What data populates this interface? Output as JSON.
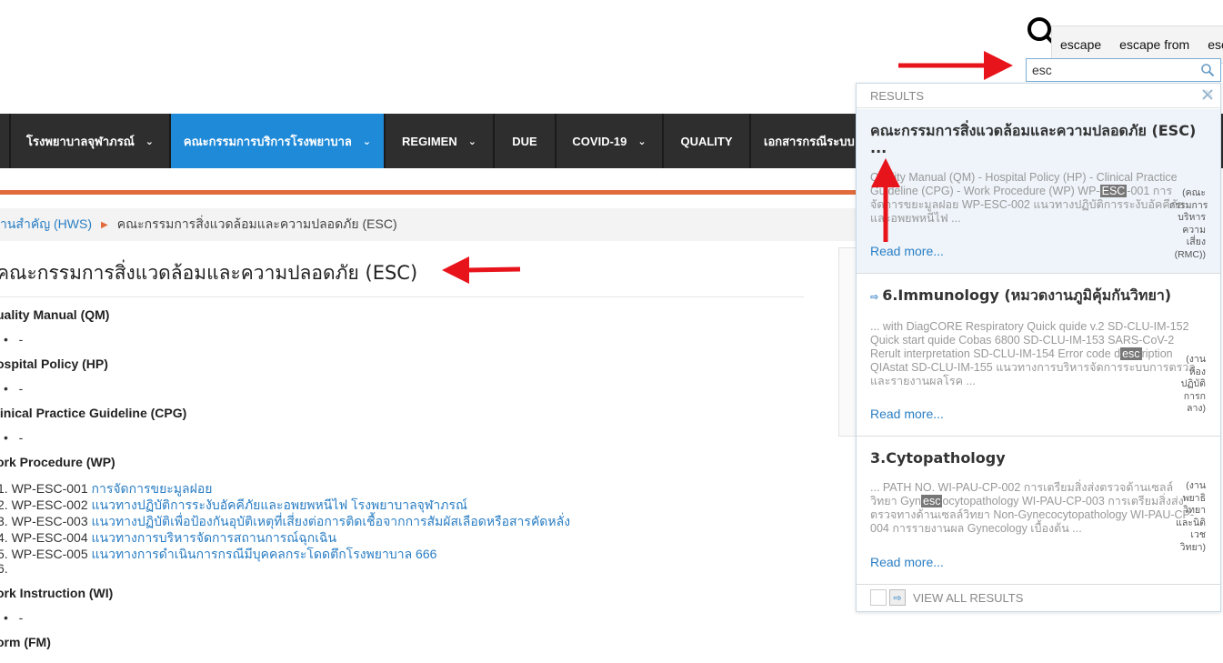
{
  "search": {
    "value": "esc",
    "suggestions": [
      "escape",
      "escape from",
      "esc"
    ]
  },
  "nav": {
    "items": [
      {
        "label": "",
        "chevron": false
      },
      {
        "label": "โรงพยาบาลจุฬาภรณ์",
        "chevron": true
      },
      {
        "label": "คณะกรรมการบริการโรงพยาบาล",
        "chevron": true
      },
      {
        "label": "REGIMEN",
        "chevron": true
      },
      {
        "label": "DUE",
        "chevron": false
      },
      {
        "label": "COVID-19",
        "chevron": true
      },
      {
        "label": "QUALITY",
        "chevron": false
      },
      {
        "label": "เอกสารกรณีระบบ",
        "chevron": false
      }
    ]
  },
  "breadcrumb": {
    "parent": "านสำคัญ (HWS)",
    "current": "คณะกรรมการสิ่งแวดล้อมและความปลอดภัย (ESC)"
  },
  "page": {
    "title": "คณะกรรมการสิ่งแวดล้อมและความปลอดภัย (ESC)",
    "sections": {
      "qm": "uality Manual (QM)",
      "hp": "ospital Policy (HP)",
      "cpg": "linical Practice Guideline (CPG)",
      "wp": "ork Procedure (WP)",
      "wi": "ork Instruction (WI)",
      "fm": "orm (FM)"
    },
    "dash": "-",
    "wp_items": [
      {
        "num": "1.",
        "code": "WP-ESC-001",
        "link": "การจัดการขยะมูลฝอย"
      },
      {
        "num": "2.",
        "code": "WP-ESC-002",
        "link": "แนวทางปฏิบัติการระงับอัคคีภัยและอพยพหนีไฟ  โรงพยาบาลจุฬาภรณ์"
      },
      {
        "num": "3.",
        "code": "WP-ESC-003",
        "link": "แนวทางปฏิบัติเพื่อป้องกันอุบัติเหตุที่เสี่ยงต่อการติดเชื้อจากการสัมผัสเลือดหรือสารคัดหลั่ง"
      },
      {
        "num": "4.",
        "code": "WP-ESC-004",
        "link": "แนวทางการบริหารจัดการสถานการณ์ฉุกเฉิน"
      },
      {
        "num": "5.",
        "code": "WP-ESC-005",
        "link": "แนวทางการดำเนินการกรณีมีบุคคลกระโดดตึกโรงพยาบาล 666"
      },
      {
        "num": "6.",
        "code": "",
        "link": ""
      }
    ]
  },
  "results": {
    "header": "RESULTS",
    "read_more": "Read more...",
    "footer": "VIEW ALL RESULTS",
    "items": [
      {
        "title": "คณะกรรมการสิ่งแวดล้อมและความปลอดภัย (ESC) ...",
        "snip_a": "Quality Manual (QM) - Hospital Policy (HP) - Clinical Practice Guideline (CPG) - Work Procedure (WP) WP-",
        "snip_hl": "ESC",
        "snip_b": "-001 การจัดการขยะมูลฝอย WP-ESC-002 แนวทางปฏิบัติการระงับอัคคีภัยและอพยพหนีไฟ ...",
        "category": "(คณะกรรมการบริหารความเสี่ยง (RMC))"
      },
      {
        "title": "6.Immunology (หมวดงานภูมิคุ้มกันวิทยา)",
        "snip_a": "... with DiagCORE Respiratory Quick quide v.2 SD-CLU-IM-152 Quick start quide Cobas 6800 SD-CLU-IM-153 SARS-CoV-2 Rerult interpretation SD-CLU-IM-154 Error code d",
        "snip_hl": "esc",
        "snip_b": "ription QIAstat SD-CLU-IM-155 แนวทางการบริหารจัดการระบบการตรวจและรายงานผลโรค ...",
        "category": "(งานห้องปฏิบัติการกลาง)"
      },
      {
        "title": "3.Cytopathology",
        "snip_a": "... PATH NO. WI-PAU-CP-002 การเตรียมสิ่งส่งตรวจด้านเซลล์วิทยา Gyn",
        "snip_hl": "esc",
        "snip_b": "ocytopathology WI-PAU-CP-003 การเตรียมสิ่งส่งตรวจทางด้านเซลล์วิทยา Non-Gynecocytopathology WI-PAU-CP-004 การรายงานผล Gynecology เบื้องต้น ...",
        "category": "(งานพยาธิวิทยาและนิติเวชวิทยา)"
      }
    ]
  },
  "colors": {
    "nav_bg": "#2e2e2e",
    "nav_active": "#1f8ad8",
    "accent_orange": "#e06a3b",
    "link": "#2a7ec4",
    "arrow": "#e8141b"
  }
}
